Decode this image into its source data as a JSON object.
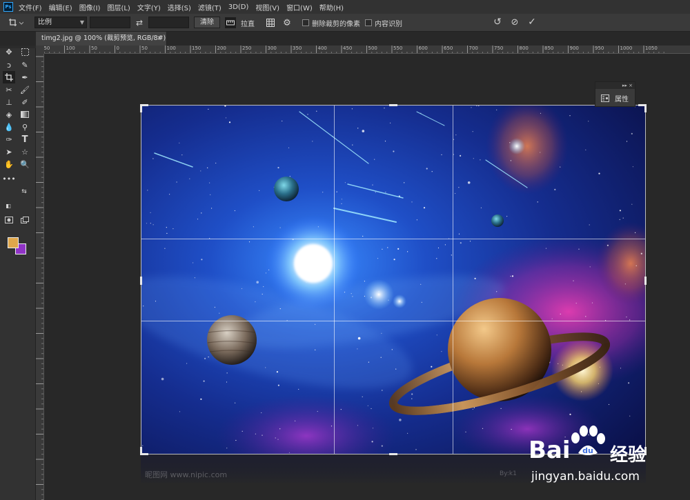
{
  "menubar": {
    "logo": "Ps",
    "items": [
      "文件(F)",
      "编辑(E)",
      "图像(I)",
      "图层(L)",
      "文字(Y)",
      "选择(S)",
      "滤镜(T)",
      "3D(D)",
      "视图(V)",
      "窗口(W)",
      "帮助(H)"
    ]
  },
  "options": {
    "ratio": "比例",
    "clear": "清除",
    "straighten": "拉直",
    "delete_cropped": "删除裁剪的像素",
    "content_aware": "内容识别"
  },
  "document": {
    "tab_title": "timg2.jpg @ 100% (裁剪预览, RGB/8#)",
    "close": "×"
  },
  "ruler_top_labels": [
    "150",
    "100",
    "50",
    "0",
    "50",
    "100",
    "150",
    "200",
    "250",
    "300",
    "350",
    "400",
    "450",
    "500",
    "550",
    "600",
    "650",
    "700",
    "750",
    "800",
    "850",
    "900",
    "950",
    "1000",
    "1050"
  ],
  "properties_panel": {
    "label": "属性",
    "controls": "▸▸  ×"
  },
  "watermark": {
    "brand": "Bai",
    "brand2": "du",
    "cn": "经验",
    "url": "jingyan.baidu.com"
  },
  "canvas_bottom": {
    "left": "昵图网 www.nipic.com",
    "right": "By:k1"
  },
  "colors": {
    "foreground": "#e0a74b",
    "background": "#9033c6",
    "accent": "#31a8ff"
  }
}
